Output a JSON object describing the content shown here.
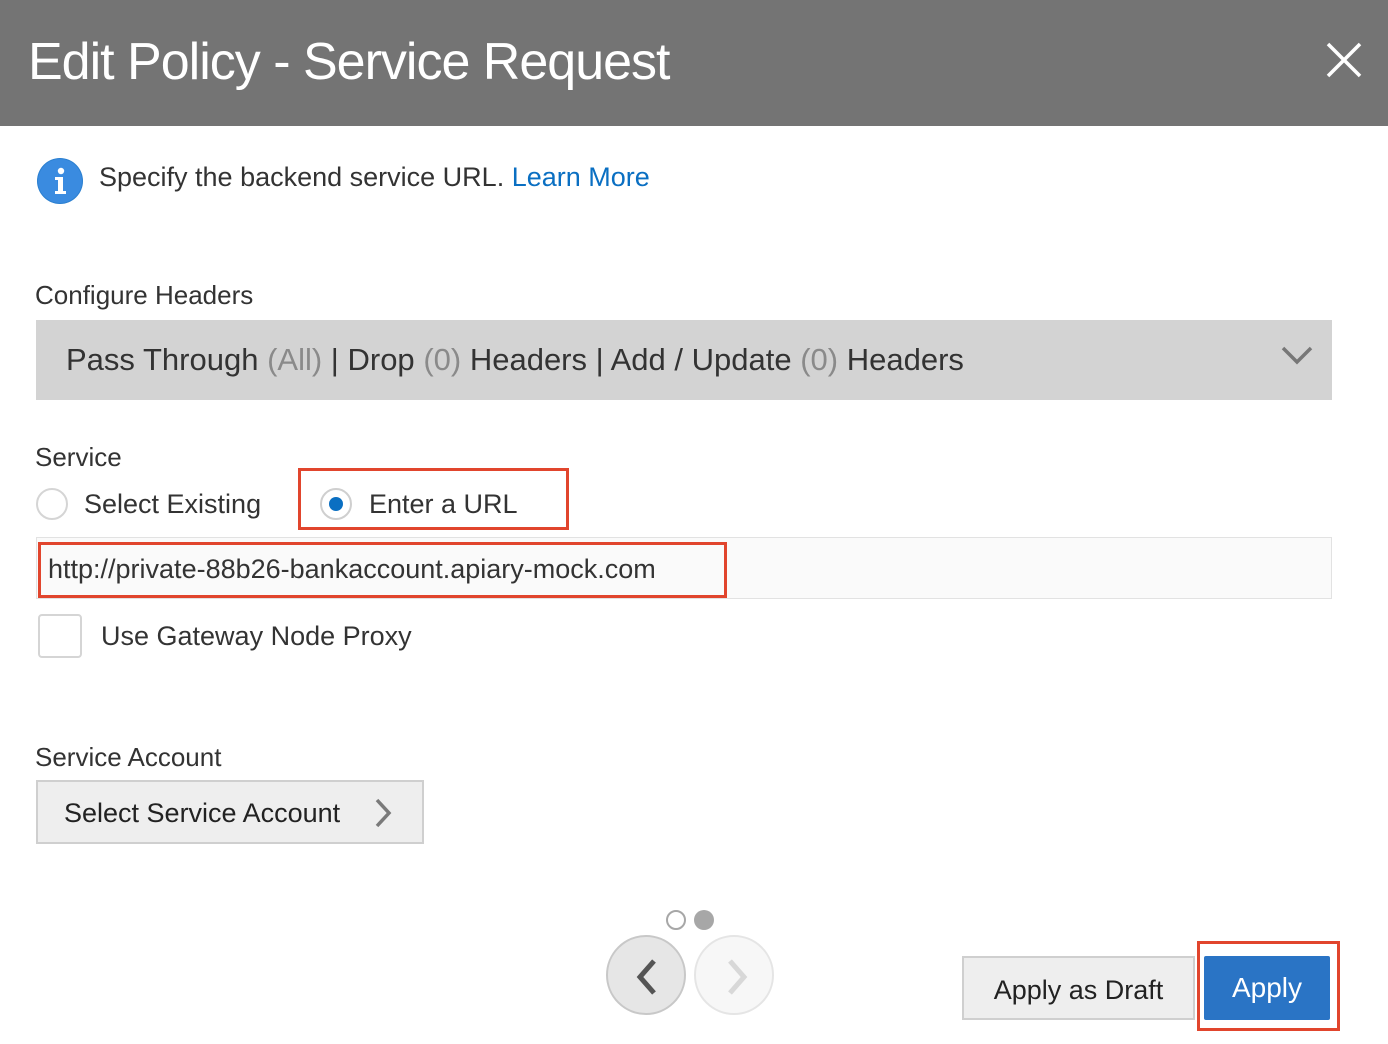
{
  "dialog": {
    "title": "Edit Policy - Service Request",
    "close_icon": "close-icon"
  },
  "info": {
    "icon": "info-icon",
    "text": "Specify the backend service URL.",
    "link": "Learn More"
  },
  "configure_headers": {
    "label": "Configure Headers",
    "summary": {
      "pass_through": "Pass Through",
      "pass_through_count": "(All)",
      "sep1": "|",
      "drop": "Drop",
      "drop_count": "(0)",
      "drop_suffix": "Headers",
      "sep2": "|",
      "add_update": "Add / Update",
      "add_update_count": "(0)",
      "add_update_suffix": "Headers"
    },
    "chevron_icon": "chevron-down-icon"
  },
  "service": {
    "label": "Service",
    "options": [
      {
        "label": "Select Existing",
        "selected": false
      },
      {
        "label": "Enter a URL",
        "selected": true
      }
    ],
    "url_value": "http://private-88b26-bankaccount.apiary-mock.com",
    "proxy_checkbox_label": "Use Gateway Node Proxy",
    "proxy_checked": false
  },
  "service_account": {
    "label": "Service Account",
    "button_label": "Select Service Account",
    "button_icon": "chevron-right-icon"
  },
  "pagination": {
    "pages": 2,
    "current_page": 2,
    "prev_icon": "chevron-left-icon",
    "next_icon": "chevron-right-icon"
  },
  "footer": {
    "apply_draft_label": "Apply as Draft",
    "apply_label": "Apply"
  },
  "colors": {
    "header_bg": "#747474",
    "accent": "#2a74c5",
    "link": "#0a6fc2",
    "highlight": "#e1452d",
    "select_bg": "#d3d3d3"
  }
}
